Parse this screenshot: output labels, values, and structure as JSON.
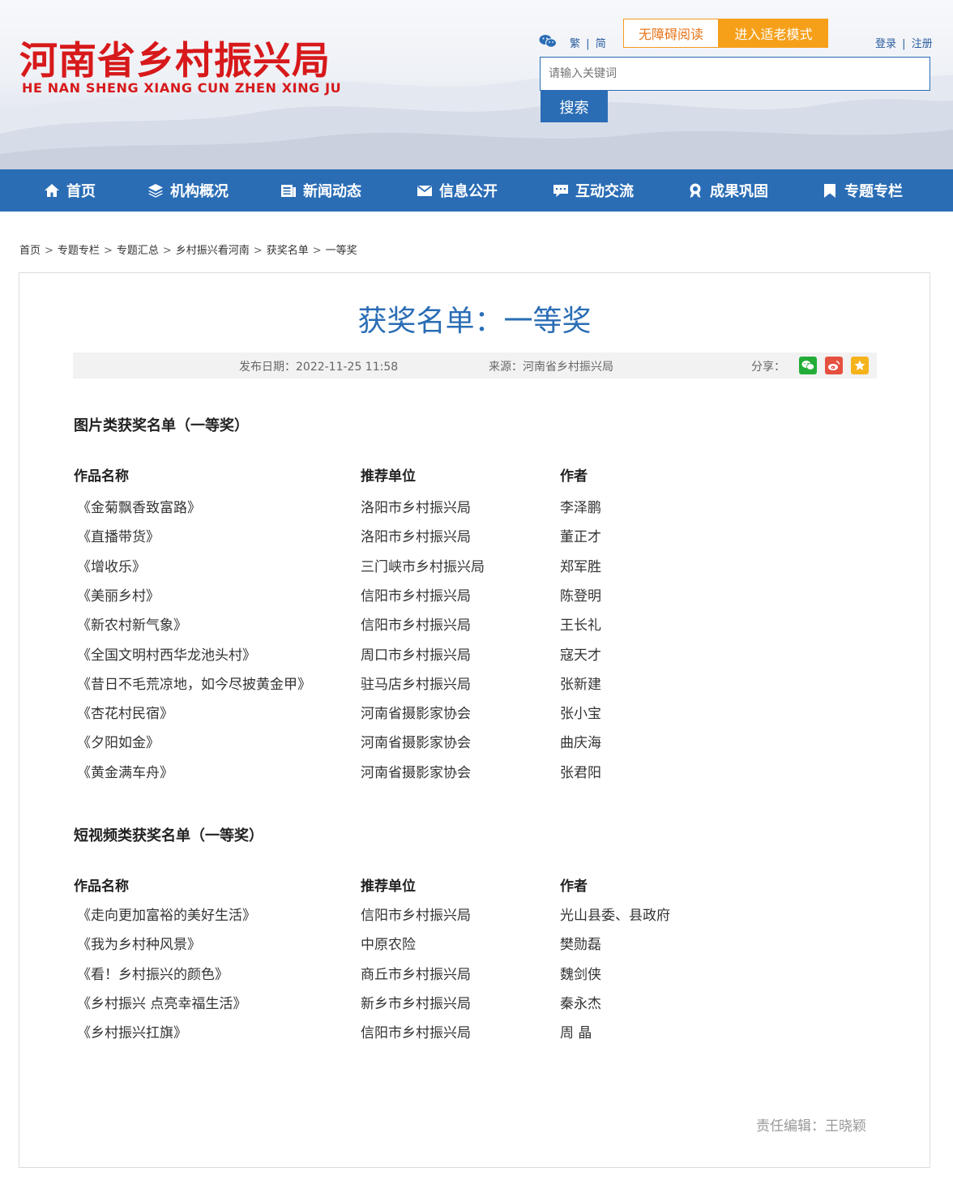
{
  "header": {
    "logo_cn": "河南省乡村振兴局",
    "logo_en": "HE NAN SHENG XIANG CUN ZHEN XING JU",
    "lang_trad": "繁",
    "lang_sep": "|",
    "lang_simp": "简",
    "accessible_label": "无障碍阅读",
    "elder_label": "进入适老模式",
    "login": "登录",
    "auth_sep": "|",
    "register": "注册",
    "search_placeholder": "请输入关键词",
    "search_button": "搜索"
  },
  "nav": [
    {
      "label": "首页",
      "icon": "home-icon"
    },
    {
      "label": "机构概况",
      "icon": "layers-icon"
    },
    {
      "label": "新闻动态",
      "icon": "news-icon"
    },
    {
      "label": "信息公开",
      "icon": "mail-icon"
    },
    {
      "label": "互动交流",
      "icon": "chat-icon"
    },
    {
      "label": "成果巩固",
      "icon": "award-icon"
    },
    {
      "label": "专题专栏",
      "icon": "bookmark-icon"
    }
  ],
  "breadcrumb": [
    "首页",
    "专题专栏",
    "专题汇总",
    "乡村振兴看河南",
    "获奖名单",
    "一等奖"
  ],
  "breadcrumb_sep": ">",
  "article": {
    "title": "获奖名单：一等奖",
    "date": "发布日期：2022-11-25 11:58",
    "source": "来源：河南省乡村振兴局",
    "share": "分享：",
    "editor": "责任编辑：王晓颖"
  },
  "sections": [
    {
      "title": "图片类获奖名单（一等奖）",
      "headers": [
        "作品名称",
        "推荐单位",
        "作者"
      ],
      "rows": [
        [
          "《金菊飘香致富路》",
          "洛阳市乡村振兴局",
          "李泽鹏"
        ],
        [
          "《直播带货》",
          "洛阳市乡村振兴局",
          "董正才"
        ],
        [
          "《增收乐》",
          "三门峡市乡村振兴局",
          "郑军胜"
        ],
        [
          "《美丽乡村》",
          "信阳市乡村振兴局",
          "陈登明"
        ],
        [
          "《新农村新气象》",
          "信阳市乡村振兴局",
          "王长礼"
        ],
        [
          "《全国文明村西华龙池头村》",
          "周口市乡村振兴局",
          "寇天才"
        ],
        [
          "《昔日不毛荒凉地，如今尽披黄金甲》",
          "驻马店乡村振兴局",
          "张新建"
        ],
        [
          "《杏花村民宿》",
          "河南省摄影家协会",
          "张小宝"
        ],
        [
          "《夕阳如金》",
          "河南省摄影家协会",
          "曲庆海"
        ],
        [
          "《黄金满车舟》",
          "河南省摄影家协会",
          "张君阳"
        ]
      ]
    },
    {
      "title": "短视频类获奖名单（一等奖）",
      "headers": [
        "作品名称",
        "推荐单位",
        "作者"
      ],
      "rows": [
        [
          "《走向更加富裕的美好生活》",
          "信阳市乡村振兴局",
          "光山县委、县政府"
        ],
        [
          "《我为乡村种风景》",
          "中原农险",
          "樊勋磊"
        ],
        [
          "《看！乡村振兴的颜色》",
          "商丘市乡村振兴局",
          "魏剑侠"
        ],
        [
          "《乡村振兴 点亮幸福生活》",
          "新乡市乡村振兴局",
          "秦永杰"
        ],
        [
          "《乡村振兴扛旗》",
          "信阳市乡村振兴局",
          "周 晶"
        ]
      ]
    }
  ],
  "colors": {
    "brand_red": "#d7191b",
    "primary_blue": "#2a6db5",
    "accent_orange": "#f6a01a"
  }
}
